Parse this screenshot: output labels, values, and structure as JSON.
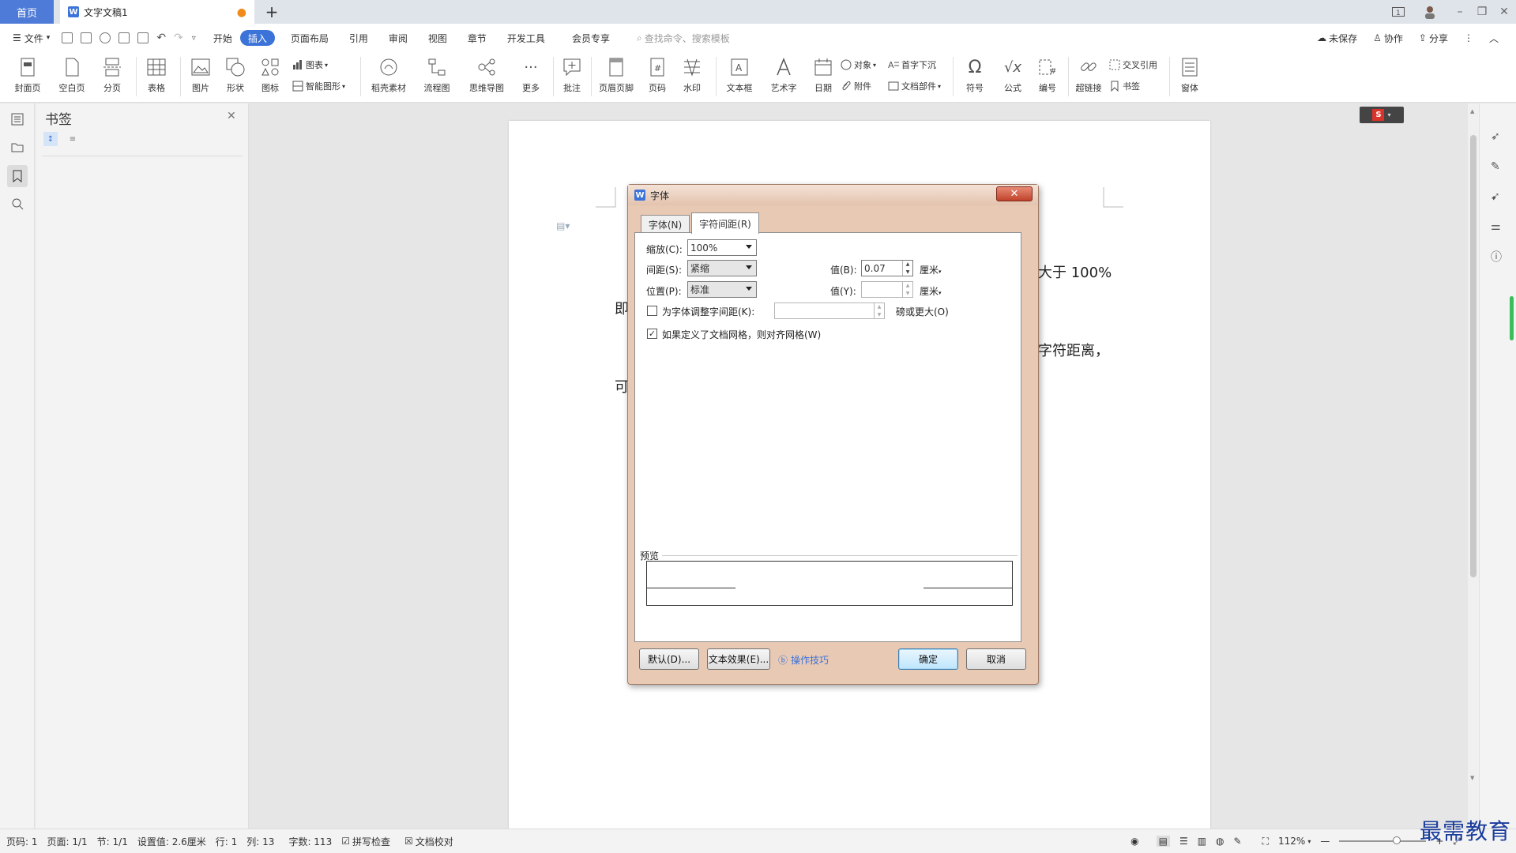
{
  "tabs": {
    "home": "首页",
    "doc_title": "文字文稿1",
    "new_tab": "+"
  },
  "menu": {
    "file": "文件",
    "items": [
      "开始",
      "插入",
      "页面布局",
      "引用",
      "审阅",
      "视图",
      "章节",
      "开发工具",
      "会员专享"
    ],
    "active": "插入",
    "search_placeholder": "查找命令、搜索模板",
    "unsaved": "未保存",
    "collaborate": "协作",
    "share": "分享"
  },
  "ribbon": {
    "cover": "封面页",
    "blank": "空白页",
    "pagebreak": "分页",
    "table": "表格",
    "picture": "图片",
    "shape": "形状",
    "icon": "图标",
    "chart": "图表",
    "smartart": "智能图形",
    "material": "稻壳素材",
    "flowchart": "流程图",
    "mindmap": "思维导图",
    "more": "更多",
    "comment": "批注",
    "headerfooter": "页眉页脚",
    "pagenum": "页码",
    "watermark": "水印",
    "textbox": "文本框",
    "wordart": "艺术字",
    "date": "日期",
    "object": "对象",
    "attachment": "附件",
    "dropcap": "首字下沉",
    "docparts": "文档部件",
    "symbol": "符号",
    "formula": "公式",
    "numbering": "编号",
    "hyperlink": "超链接",
    "crossref": "交叉引用",
    "bookmark": "书签",
    "window": "窗体"
  },
  "sidebar": {
    "title": "书签"
  },
  "document": {
    "line1_tail": "大于 100%",
    "line2_start": "即",
    "line3_tail": "字符距离，",
    "line4_start": "可"
  },
  "dialog": {
    "title": "字体",
    "tab_font": "字体(N)",
    "tab_spacing": "字符间距(R)",
    "scale_label": "缩放(C):",
    "scale_value": "100%",
    "spacing_label": "间距(S):",
    "spacing_value": "紧缩",
    "value_b_label": "值(B):",
    "value_b": "0.07",
    "unit_b": "厘米",
    "position_label": "位置(P):",
    "position_value": "标准",
    "value_y_label": "值(Y):",
    "value_y": "",
    "unit_y": "厘米",
    "kerning_label": "为字体调整字间距(K):",
    "kerning_value": "",
    "kerning_suffix": "磅或更大(O)",
    "kerning_checked": false,
    "grid_label": "如果定义了文档网格，则对齐网格(W)",
    "grid_checked": true,
    "preview_label": "预览",
    "btn_default": "默认(D)...",
    "btn_effects": "文本效果(E)...",
    "tips": "操作技巧",
    "btn_ok": "确定",
    "btn_cancel": "取消"
  },
  "status": {
    "page": "页码: 1",
    "pages": "页面: 1/1",
    "section": "节: 1/1",
    "setting": "设置值: 2.6厘米",
    "row": "行: 1",
    "col": "列: 13",
    "words": "字数: 113",
    "spellcheck": "拼写检查",
    "proofread": "文档校对",
    "zoom": "112%"
  },
  "watermark": "最需教育",
  "colors": {
    "accent": "#3b73d9",
    "dialog_frame": "#e8c9b4",
    "close_button": "#c9492f"
  }
}
